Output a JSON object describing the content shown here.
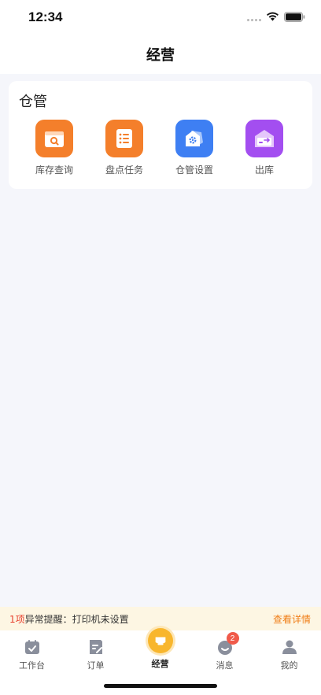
{
  "status_bar": {
    "time": "12:34"
  },
  "header": {
    "title": "经营"
  },
  "warehouse": {
    "title": "仓管",
    "items": [
      {
        "label": "库存查询",
        "icon": "inventory-search-icon",
        "color": "#f47f2b"
      },
      {
        "label": "盘点任务",
        "icon": "stocktake-list-icon",
        "color": "#f47f2b"
      },
      {
        "label": "仓管设置",
        "icon": "warehouse-settings-icon",
        "color": "#3e7ff3"
      },
      {
        "label": "出库",
        "icon": "outbound-icon",
        "color": "#a34ef0"
      }
    ]
  },
  "alert": {
    "count": "1项",
    "message": "异常提醒：打印机未设置",
    "link": "查看详情"
  },
  "tabbar": {
    "items": [
      {
        "label": "工作台",
        "icon": "workbench-calendar-icon"
      },
      {
        "label": "订单",
        "icon": "order-icon"
      },
      {
        "label": "经营",
        "icon": "business-icon",
        "active": true
      },
      {
        "label": "消息",
        "icon": "message-icon",
        "badge": "2"
      },
      {
        "label": "我的",
        "icon": "profile-icon"
      }
    ]
  }
}
